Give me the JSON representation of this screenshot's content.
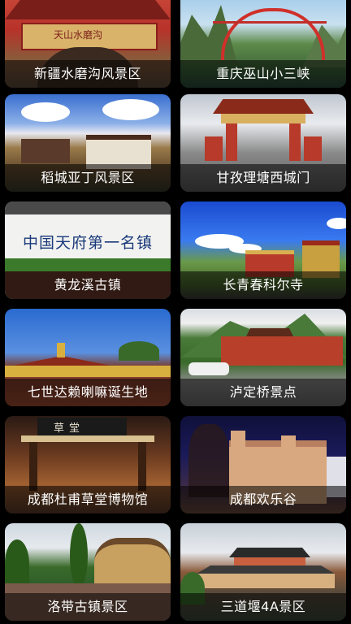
{
  "cards": [
    {
      "label": "新疆水磨沟风景区"
    },
    {
      "label": "重庆巫山小三峡"
    },
    {
      "label": "稻城亚丁风景区"
    },
    {
      "label": "甘孜理塘西城门"
    },
    {
      "label": "黄龙溪古镇"
    },
    {
      "label": "长青春科尔寺"
    },
    {
      "label": "七世达赖喇嘛诞生地"
    },
    {
      "label": "泸定桥景点"
    },
    {
      "label": "成都杜甫草堂博物馆"
    },
    {
      "label": "成都欢乐谷"
    },
    {
      "label": "洛带古镇景区"
    },
    {
      "label": "三道堰4A景区"
    }
  ],
  "signs": {
    "card1_sign": "天山水磨沟",
    "card5_wall": "中国天府第一名镇",
    "card9_banner": "草堂"
  },
  "colors": {
    "label_bg": "rgba(0,0,0,0.55)",
    "label_text": "#ffffff",
    "page_bg": "#000000"
  }
}
